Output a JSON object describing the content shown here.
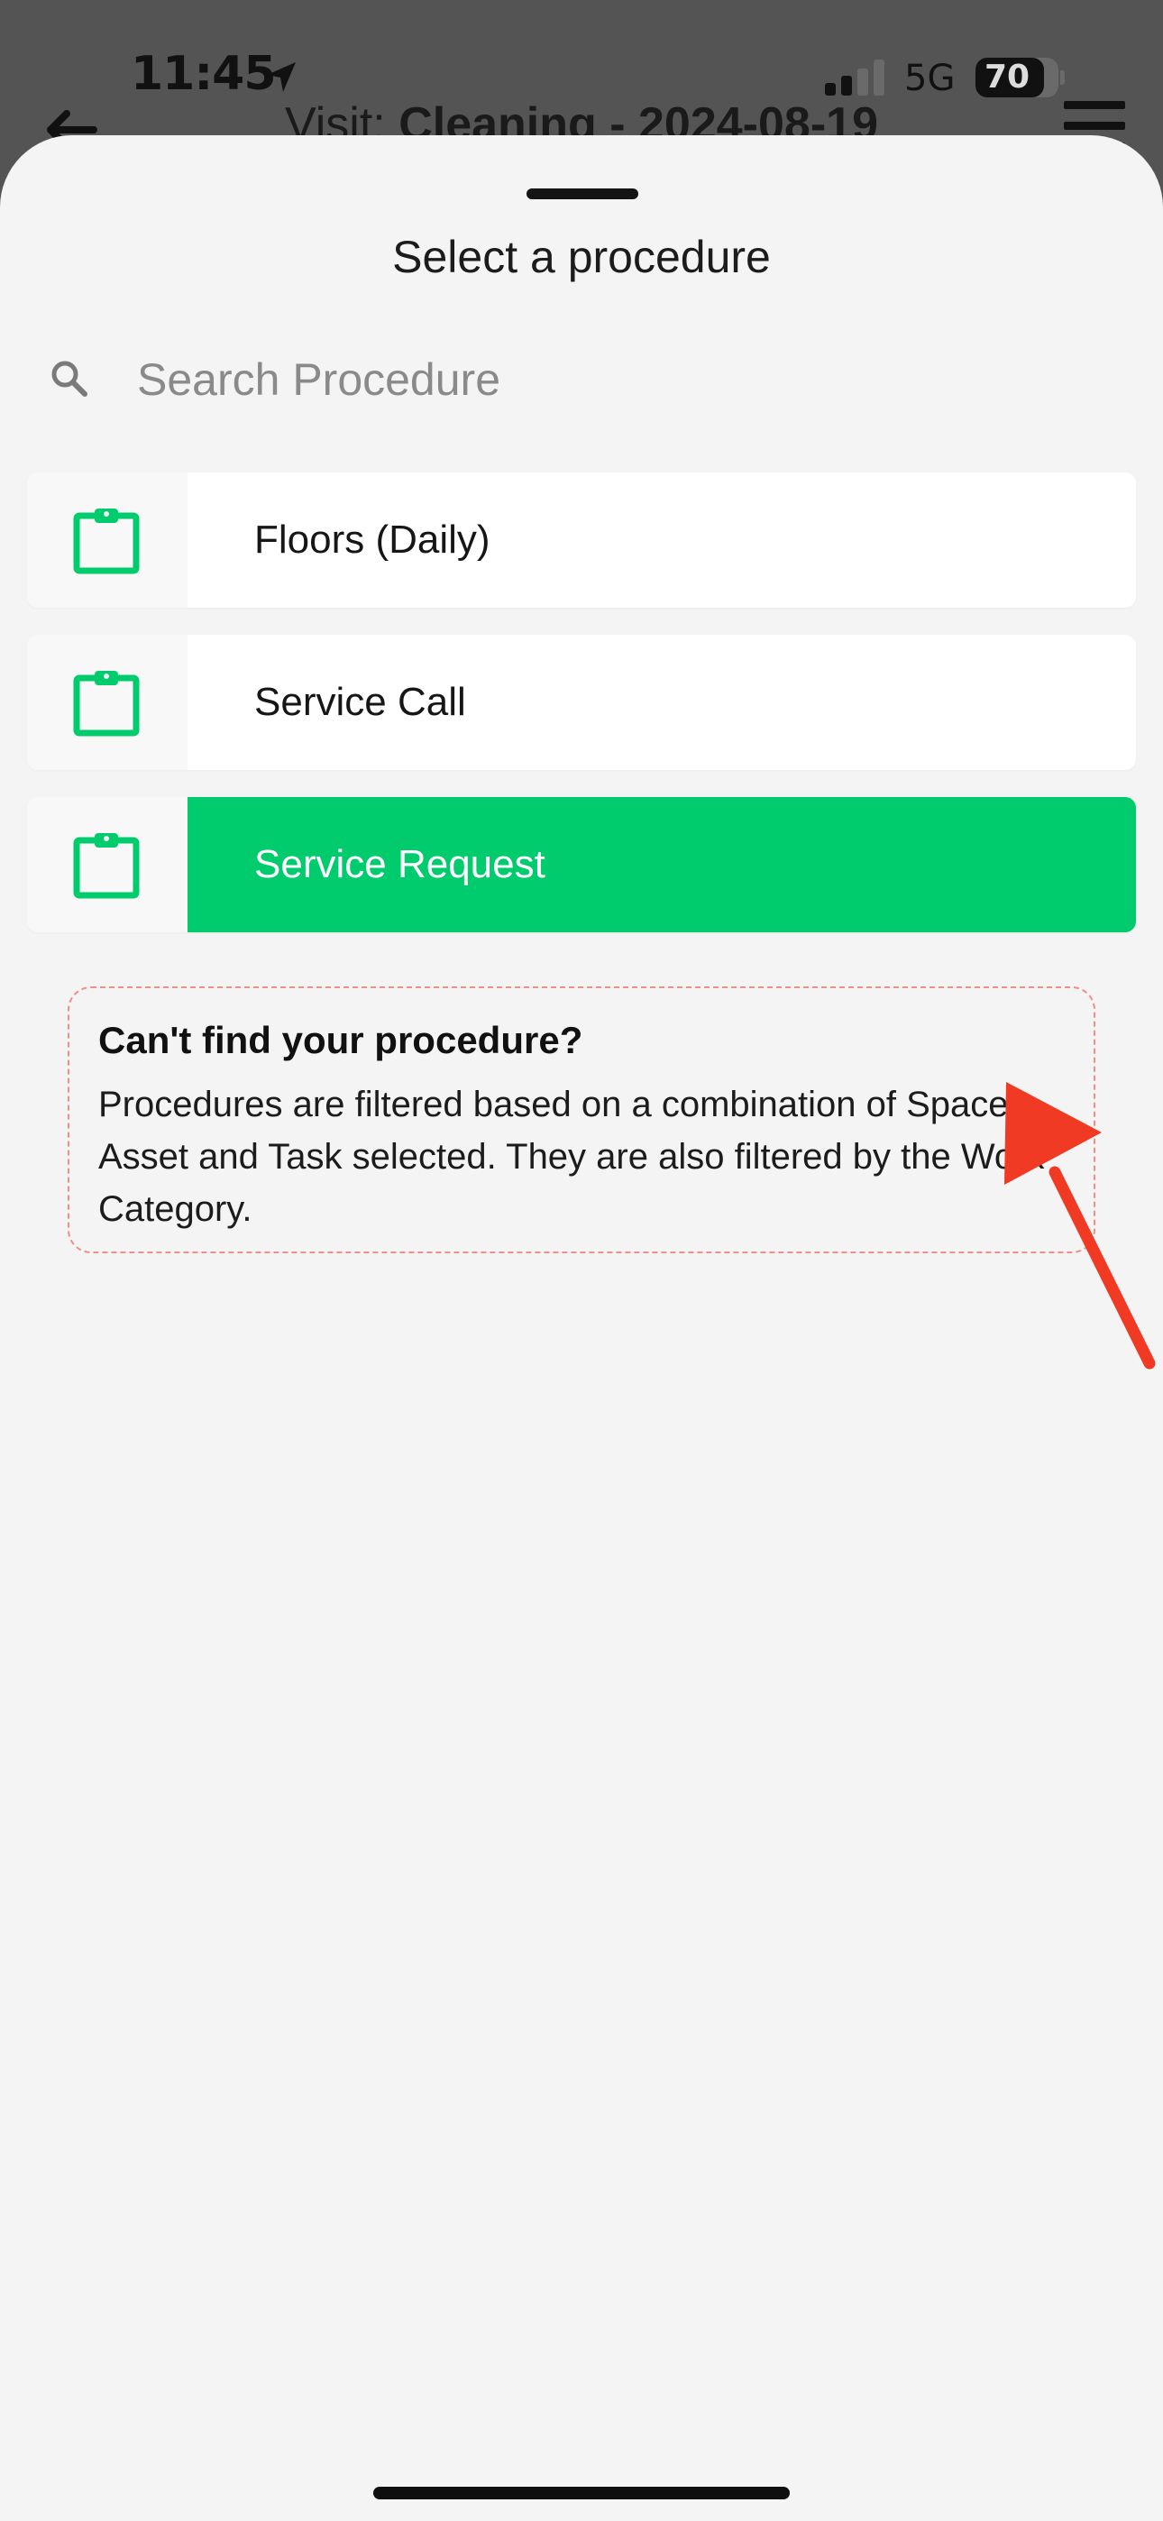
{
  "status_bar": {
    "time": "11:45",
    "network": "5G",
    "battery": "70"
  },
  "background_screen": {
    "title_prefix": "Visit: ",
    "title_bold": "Cleaning - 2024-08-19"
  },
  "sheet": {
    "title": "Select a procedure",
    "search": {
      "placeholder": "Search Procedure",
      "value": ""
    },
    "procedures": [
      {
        "label": "Floors (Daily)",
        "icon": "clipboard-icon",
        "selected": false
      },
      {
        "label": "Service Call",
        "icon": "clipboard-icon",
        "selected": false
      },
      {
        "label": "Service Request",
        "icon": "clipboard-icon",
        "selected": true
      }
    ],
    "info": {
      "title": "Can't find your procedure?",
      "body": "Procedures are filtered based on a combination of Space, Asset and Task selected. They are also filtered by the Work Category."
    }
  },
  "colors": {
    "accent_green": "#00cc6d",
    "annotation_red": "#f03a24",
    "info_border": "#ef8f86",
    "sheet_background": "#f4f4f4"
  },
  "annotation": {
    "type": "red-arrow",
    "points_to": "Service Request"
  }
}
